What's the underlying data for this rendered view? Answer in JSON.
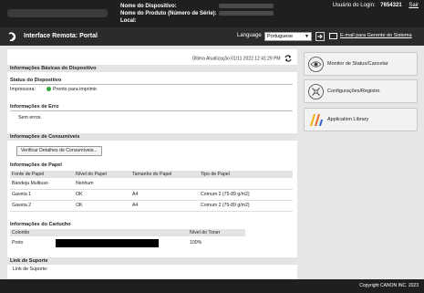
{
  "header": {
    "device_name_label": "Nome do Dispositivo:",
    "product_name_label": "Nome do Produto (Número de Série):",
    "location_label": "Local:",
    "login_user_label": "Usuário do Login:",
    "login_user_value": "7654321",
    "logout_label": "Sair"
  },
  "nav": {
    "title": "Interface Remota: Portal",
    "language_label": "Language",
    "language_value": "Portuguese",
    "admin_mail_label": "E-mail para Gerente do Sistema"
  },
  "main": {
    "last_update": "Última Atualização 01/11 2022 12:41:29 PM",
    "basic_info": {
      "title": "Informações Básicas do Dispositivo",
      "status_title": "Status do Dispositivo",
      "printer_label": "Impressora:",
      "printer_status": "Pronto para imprimir.",
      "status_color": "#2eaa3c",
      "error_title": "Informações de Erro",
      "error_value": "Sem erros."
    },
    "consumables": {
      "title": "Informações de Consumíveis",
      "check_button": "Verificar Detalhes de Consumíveis...",
      "paper_title": "Informações de Papel",
      "paper_columns": [
        "Fonte de Papel",
        "Nível do Papel",
        "Tamanho do Papel",
        "Tipo de Papel"
      ],
      "paper_rows": [
        [
          "Bandeja Multiuso",
          "Nenhum",
          "",
          ""
        ],
        [
          "Gaveta 1",
          "OK",
          "A4",
          "Comum 2 (75-89 g/m2)"
        ],
        [
          "Gaveta 2",
          "OK",
          "A4",
          "Comum 2 (75-89 g/m2)"
        ]
      ],
      "cartridge_title": "Informações do Cartucho",
      "cartridge_columns": [
        "Colorido",
        "Nível do Toner"
      ],
      "cartridge_row": {
        "color": "Preto",
        "toner_level": "100%",
        "toner_fraction": 1.0
      }
    },
    "support": {
      "title": "Link de Suporte",
      "link_label": "Link de Suporte:"
    }
  },
  "side": {
    "status_monitor": "Monitor de Status/Cancelar",
    "settings": "Configurações/Registro",
    "app_library": "Application Library"
  },
  "footer": {
    "copyright": "Copyright CANON INC. 2023"
  }
}
